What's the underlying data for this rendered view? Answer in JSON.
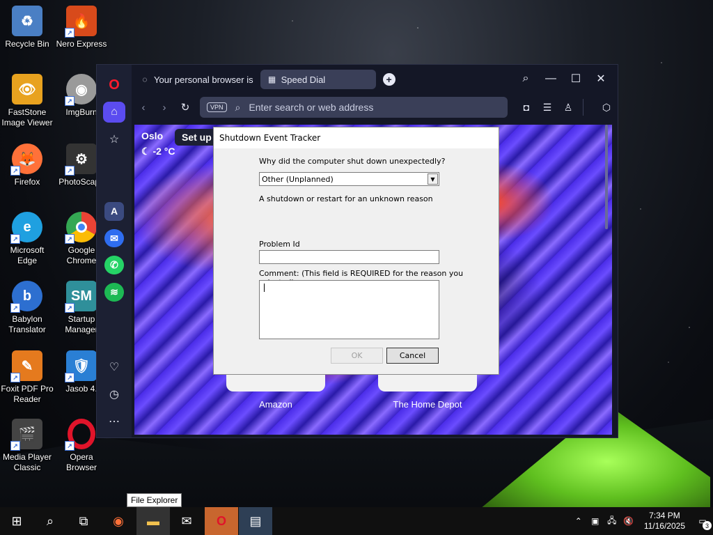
{
  "desktop": {
    "icons": [
      {
        "label": "Recycle Bin",
        "icon": "recycle-bin-icon",
        "color": "#4a7fc4"
      },
      {
        "label": "Nero Express",
        "icon": "nero-express-icon",
        "color": "#d84a1b"
      },
      {
        "label": "FastStone Image Viewer",
        "icon": "faststone-icon",
        "color": "#e8a21f"
      },
      {
        "label": "ImgBurn",
        "icon": "imgburn-icon",
        "color": "#9a9a9a"
      },
      {
        "label": "Firefox",
        "icon": "firefox-icon",
        "color": "#ff7139"
      },
      {
        "label": "PhotoScape",
        "icon": "photoscape-icon",
        "color": "#333333"
      },
      {
        "label": "Microsoft Edge",
        "icon": "edge-icon",
        "color": "#1fa0e0"
      },
      {
        "label": "Google Chrome",
        "icon": "chrome-icon",
        "color": "#34a853"
      },
      {
        "label": "Babylon Translator",
        "icon": "babylon-icon",
        "color": "#2d6fd0"
      },
      {
        "label": "Startup Manager",
        "icon": "startup-manager-icon",
        "color": "#2f8f9a"
      },
      {
        "label": "Foxit PDF Pro Reader",
        "icon": "foxit-icon",
        "color": "#e57a1e"
      },
      {
        "label": "Jasob 4.",
        "icon": "jasob-icon",
        "color": "#2a7fd4"
      },
      {
        "label": "Media Player Classic",
        "icon": "media-player-classic-icon",
        "color": "#444444"
      },
      {
        "label": "Opera Browser",
        "icon": "opera-icon",
        "color": "#e0142a"
      }
    ]
  },
  "browser": {
    "tabs": [
      {
        "label": "Your personal browser is"
      },
      {
        "label": "Speed Dial"
      }
    ],
    "address_placeholder": "Enter search or web address",
    "vpn_label": "VPN",
    "weather_city": "Oslo",
    "weather_temp": "-2 °C",
    "setup_label": "Set up",
    "speed_dials": [
      {
        "label": "Amazon"
      },
      {
        "label": "The Home Depot"
      }
    ]
  },
  "dialog": {
    "title": "Shutdown Event Tracker",
    "question": "Why did the computer shut down unexpectedly?",
    "selected_reason": "Other (Unplanned)",
    "reason_description": "A shutdown or restart for an unknown reason",
    "problem_id_label": "Problem Id",
    "problem_id_value": "",
    "comment_label": "Comment: (This field is REQUIRED for the reason you selected)",
    "comment_value": "",
    "ok_label": "OK",
    "cancel_label": "Cancel"
  },
  "tooltip": "File Explorer",
  "taskbar": {
    "time": "7:34 PM",
    "date": "11/16/2025",
    "notification_count": "3"
  }
}
